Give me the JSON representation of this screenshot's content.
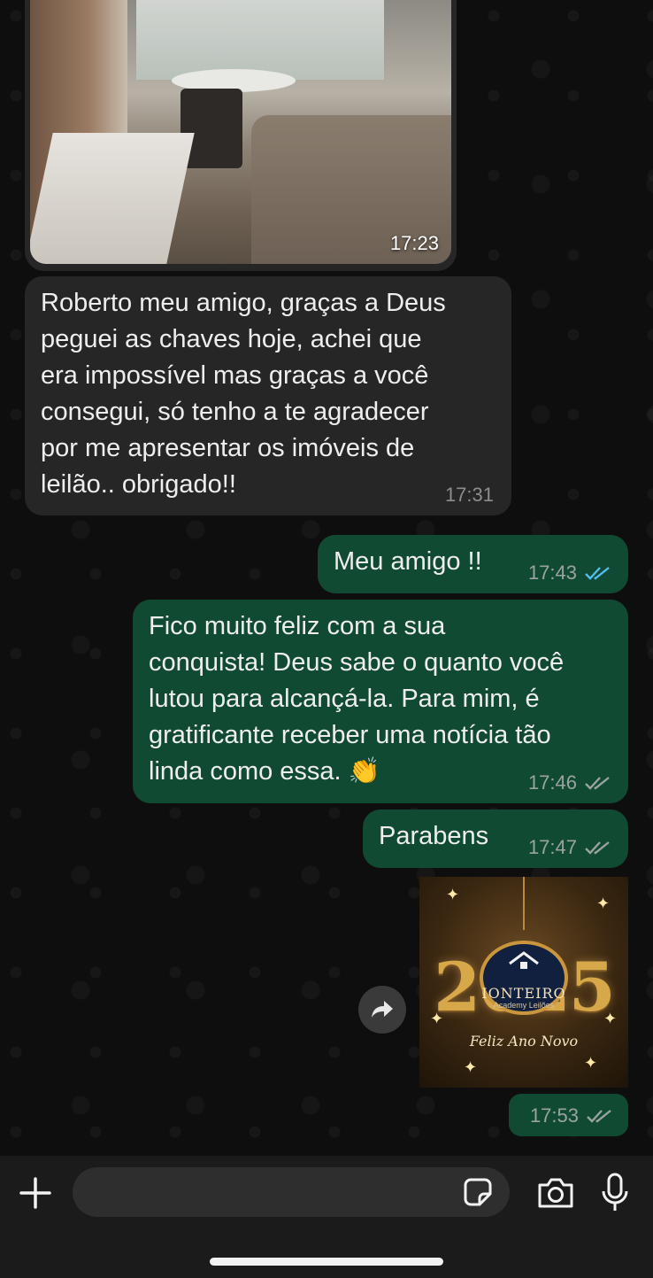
{
  "messages": [
    {
      "type": "image",
      "direction": "incoming",
      "time": "17:23"
    },
    {
      "type": "text",
      "direction": "incoming",
      "text": "Roberto meu amigo, graças a Deus\npeguei as chaves hoje, achei que\nera impossível mas graças a você\nconsegui, só tenho a te agradecer\npor me apresentar os imóveis de\nleilão.. obrigado!!",
      "time": "17:31"
    },
    {
      "type": "text",
      "direction": "outgoing",
      "text": "Meu amigo !!",
      "time": "17:43",
      "status": "read"
    },
    {
      "type": "text",
      "direction": "outgoing",
      "text": "Fico muito feliz com a sua\nconquista! Deus sabe o quanto você\nlutou para alcançá-la. Para mim, é\ngratificante receber uma notícia tão\nlinda como essa. 👏",
      "time": "17:46",
      "status": "delivered"
    },
    {
      "type": "text",
      "direction": "outgoing",
      "text": "Parabens",
      "time": "17:47",
      "status": "delivered"
    },
    {
      "type": "image",
      "direction": "outgoing",
      "time": "17:53",
      "status": "delivered",
      "image_text": {
        "year": "2025",
        "brand": "IONTEIRO",
        "subtitle": "Academy Leilões",
        "greeting": "Feliz Ano Novo"
      }
    }
  ],
  "input": {
    "placeholder": ""
  },
  "icons": {
    "plus": "plus-icon",
    "sticker": "sticker-icon",
    "camera": "camera-icon",
    "mic": "microphone-icon",
    "forward": "forward-icon",
    "read_ticks": "double-check-icon"
  },
  "colors": {
    "incoming_bubble": "#262626",
    "outgoing_bubble": "#114a33",
    "read_tick": "#53bdeb",
    "delivered_tick": "#9aa39f"
  }
}
